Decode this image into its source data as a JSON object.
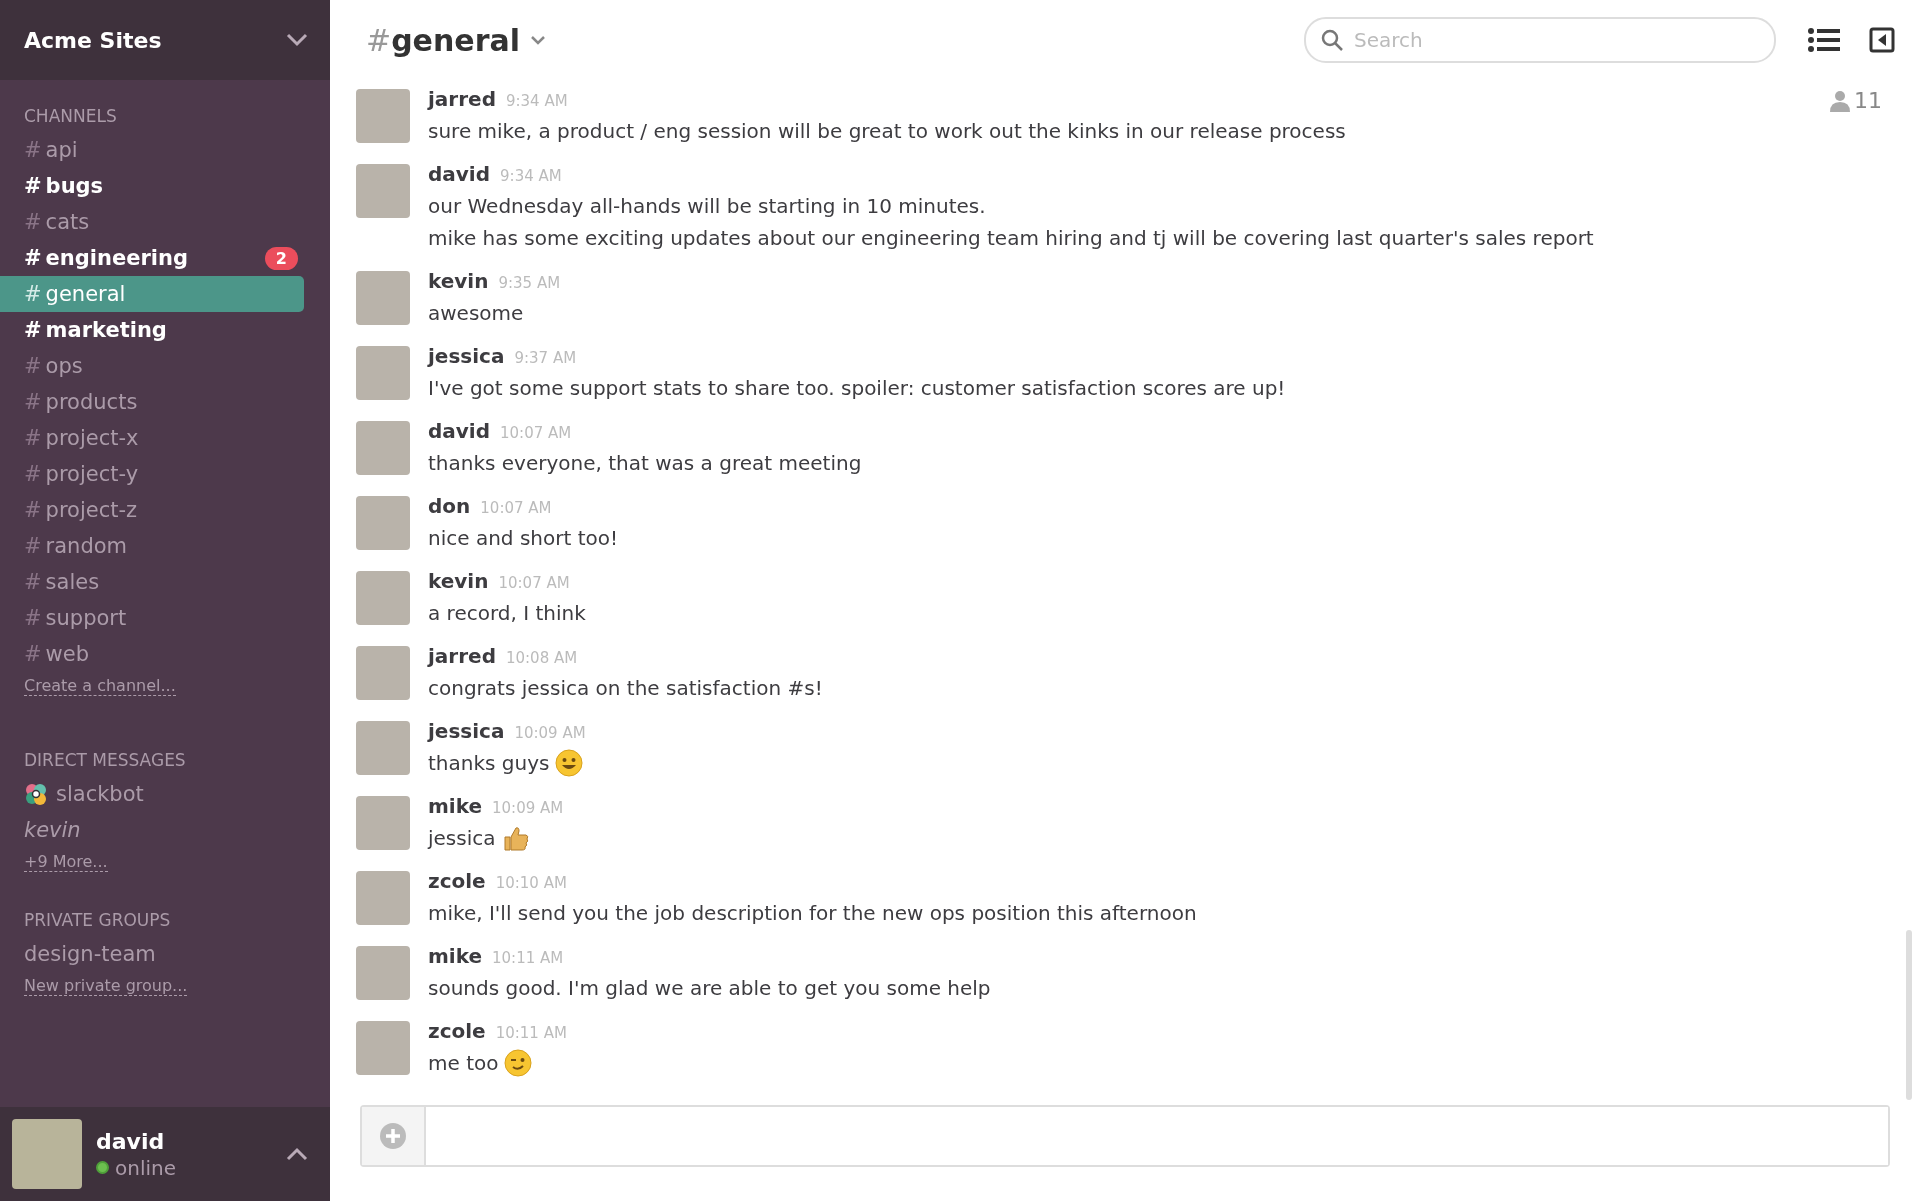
{
  "team": {
    "name": "Acme Sites"
  },
  "sidebar": {
    "channels_heading": "CHANNELS",
    "channels": [
      {
        "hash": "#",
        "name": "api",
        "unread": false,
        "selected": false
      },
      {
        "hash": "#",
        "name": "bugs",
        "unread": true,
        "selected": false
      },
      {
        "hash": "#",
        "name": "cats",
        "unread": false,
        "selected": false
      },
      {
        "hash": "#",
        "name": "engineering",
        "unread": true,
        "selected": false,
        "badge": "2"
      },
      {
        "hash": "#",
        "name": "general",
        "unread": false,
        "selected": true
      },
      {
        "hash": "#",
        "name": "marketing",
        "unread": true,
        "selected": false
      },
      {
        "hash": "#",
        "name": "ops",
        "unread": false,
        "selected": false
      },
      {
        "hash": "#",
        "name": "products",
        "unread": false,
        "selected": false
      },
      {
        "hash": "#",
        "name": "project-x",
        "unread": false,
        "selected": false
      },
      {
        "hash": "#",
        "name": "project-y",
        "unread": false,
        "selected": false
      },
      {
        "hash": "#",
        "name": "project-z",
        "unread": false,
        "selected": false
      },
      {
        "hash": "#",
        "name": "random",
        "unread": false,
        "selected": false
      },
      {
        "hash": "#",
        "name": "sales",
        "unread": false,
        "selected": false
      },
      {
        "hash": "#",
        "name": "support",
        "unread": false,
        "selected": false
      },
      {
        "hash": "#",
        "name": "web",
        "unread": false,
        "selected": false
      }
    ],
    "create_channel": "Create a channel...",
    "dm_heading": "DIRECT MESSAGES",
    "direct_messages": [
      {
        "name": "slackbot",
        "kind": "bot"
      },
      {
        "name": "kevin",
        "kind": "away"
      }
    ],
    "more_link": "+9 More...",
    "groups_heading": "PRIVATE GROUPS",
    "groups": [
      {
        "name": "design-team"
      }
    ],
    "new_group": "New private group...",
    "user": {
      "name": "david",
      "status": "online",
      "online": true
    }
  },
  "header": {
    "hash": "#",
    "channel": "general",
    "search_placeholder": "Search",
    "member_count": "11"
  },
  "messages": [
    {
      "author": "jarred",
      "time": "9:34 AM",
      "lines": [
        "sure mike, a product / eng session will be great to work out the kinks in our release process"
      ]
    },
    {
      "author": "david",
      "time": "9:34 AM",
      "lines": [
        "our Wednesday all-hands will be starting in 10 minutes.",
        "mike has some exciting updates about our engineering team hiring and tj will be covering last quarter's sales report"
      ]
    },
    {
      "author": "kevin",
      "time": "9:35 AM",
      "lines": [
        "awesome"
      ]
    },
    {
      "author": "jessica",
      "time": "9:37 AM",
      "lines": [
        "I've got some support stats to share too. spoiler: customer satisfaction scores are up!"
      ]
    },
    {
      "author": "david",
      "time": "10:07 AM",
      "lines": [
        "thanks everyone, that was a great meeting"
      ]
    },
    {
      "author": "don",
      "time": "10:07 AM",
      "lines": [
        "nice and short too!"
      ]
    },
    {
      "author": "kevin",
      "time": "10:07 AM",
      "lines": [
        "a record, I think"
      ]
    },
    {
      "author": "jarred",
      "time": "10:08 AM",
      "lines": [
        "congrats jessica on the satisfaction #s!"
      ]
    },
    {
      "author": "jessica",
      "time": "10:09 AM",
      "lines": [
        "thanks guys"
      ],
      "kind": "smile"
    },
    {
      "author": "mike",
      "time": "10:09 AM",
      "lines": [
        "jessica"
      ],
      "kind": "thumbsup"
    },
    {
      "author": "zcole",
      "time": "10:10 AM",
      "lines": [
        "mike, I'll send you the job description for the new ops position this afternoon"
      ]
    },
    {
      "author": "mike",
      "time": "10:11 AM",
      "lines": [
        "sounds good. I'm glad we are able to get you some help"
      ]
    },
    {
      "author": "zcole",
      "time": "10:11 AM",
      "lines": [
        "me too"
      ],
      "kind": "wink"
    }
  ]
}
